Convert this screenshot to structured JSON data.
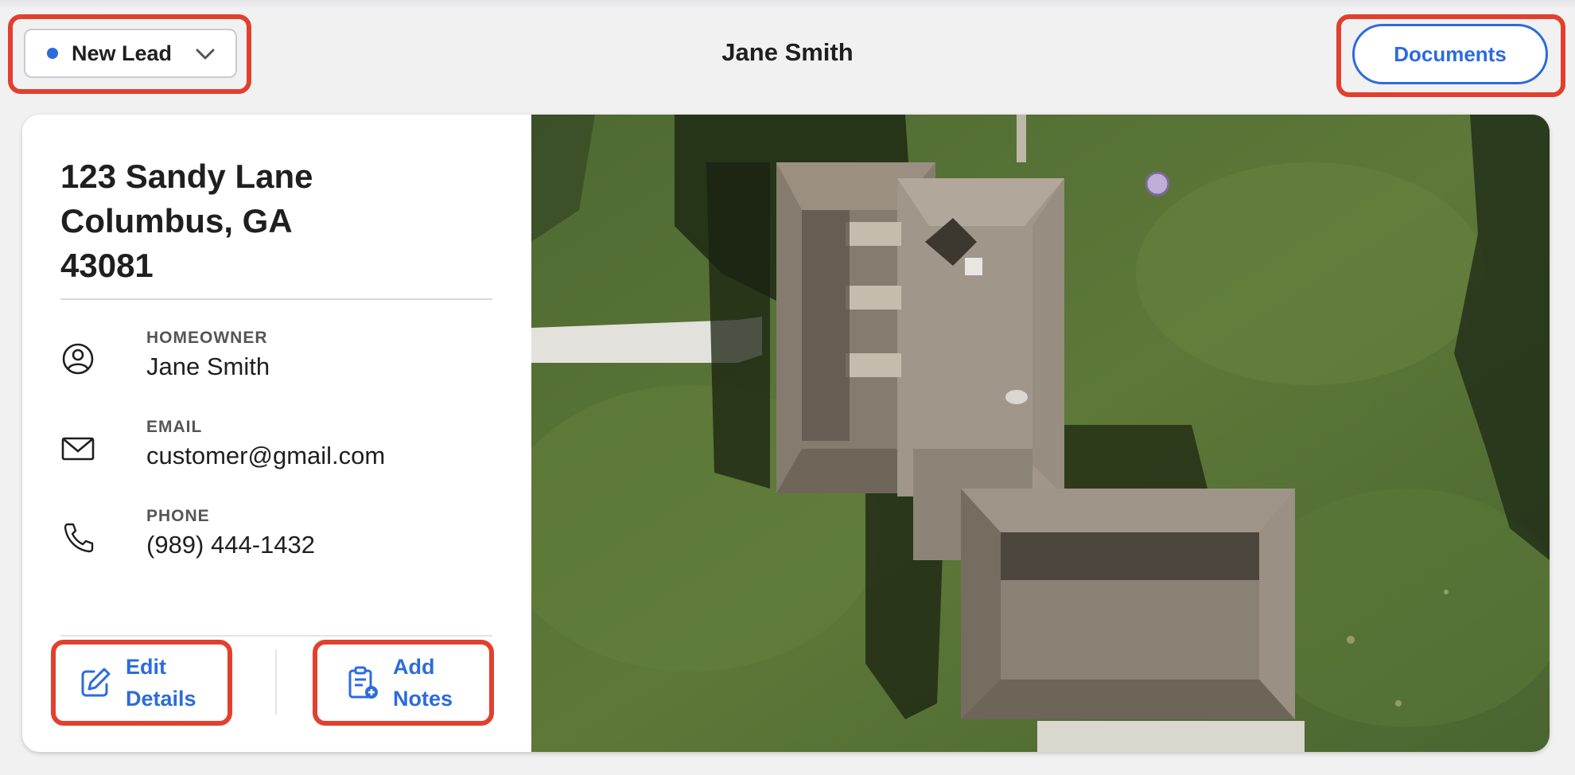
{
  "header": {
    "status": {
      "label": "New Lead",
      "dot_color": "#2d6bdd",
      "chevron_icon": "chevron-down-icon"
    },
    "title": "Jane Smith",
    "documents_label": "Documents"
  },
  "card": {
    "address": [
      "123 Sandy Lane",
      "Columbus, GA",
      "43081"
    ],
    "fields": [
      {
        "label": "HOMEOWNER",
        "value": "Jane Smith",
        "icon": "person-circle-icon"
      },
      {
        "label": "EMAIL",
        "value": "customer@gmail.com",
        "icon": "mail-icon"
      },
      {
        "label": "PHONE",
        "value": "(989) 444-1432",
        "icon": "phone-icon"
      }
    ],
    "actions": {
      "edit": {
        "label": "Edit Details",
        "icon": "edit-icon"
      },
      "notes": {
        "label": "Add Notes",
        "icon": "clipboard-add-icon"
      }
    }
  },
  "colors": {
    "accent": "#2d6bdd",
    "highlight": "#e2402e",
    "background": "#f1f1f2"
  }
}
